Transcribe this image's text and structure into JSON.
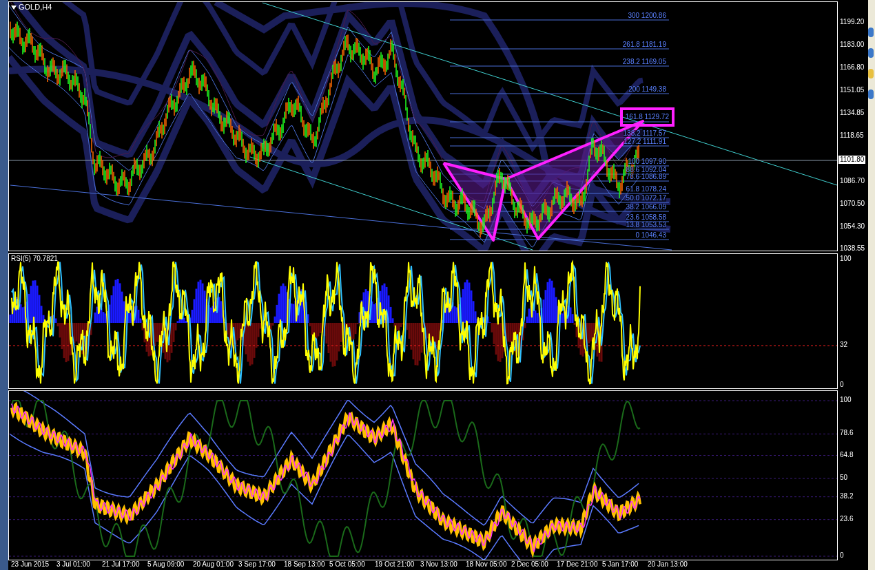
{
  "chart": {
    "title": "GOLD,H4",
    "price_axis": [
      "1199.20",
      "1183.00",
      "1166.80",
      "1151.05",
      "1134.85",
      "1118.65",
      "1086.70",
      "1070.50",
      "1054.30",
      "1038.55"
    ],
    "current_price": "1101.80",
    "fib_levels": [
      {
        "label": "300 1200.86",
        "highlighted": false
      },
      {
        "label": "261.8 1181.19",
        "highlighted": false
      },
      {
        "label": "238.2 1169.05",
        "highlighted": false
      },
      {
        "label": "200 1149.38",
        "highlighted": false
      },
      {
        "label": "161.8 1129.72",
        "highlighted": true
      },
      {
        "label": "138.2 1117.57",
        "highlighted": false
      },
      {
        "label": "127.2 1111.91",
        "highlighted": false
      },
      {
        "label": "100 1097.90",
        "highlighted": false
      },
      {
        "label": "88.6 1092.04",
        "highlighted": false
      },
      {
        "label": "78.6 1086.89",
        "highlighted": false
      },
      {
        "label": "61.8 1078.24",
        "highlighted": false
      },
      {
        "label": "50.0 1072.17",
        "highlighted": false
      },
      {
        "label": "38.2 1066.09",
        "highlighted": false
      },
      {
        "label": "23.6 1058.58",
        "highlighted": false
      },
      {
        "label": "13.8 1053.53",
        "highlighted": false
      },
      {
        "label": "0 1046.43",
        "highlighted": false
      }
    ]
  },
  "rsi_pane": {
    "title": "RSI(5) 70.7821",
    "axis": [
      "100",
      "32",
      "0"
    ]
  },
  "oscillator_pane": {
    "axis": [
      "100",
      "78.6",
      "64.8",
      "50",
      "38.2",
      "23.6",
      "0"
    ]
  },
  "time_axis": [
    "23 Jun 2015",
    "3 Jul 01:00",
    "21 Jul 17:00",
    "5 Aug 09:00",
    "20 Aug 01:00",
    "3 Sep 17:00",
    "18 Sep 13:00",
    "5 Oct 05:00",
    "19 Oct 21:00",
    "3 Nov 13:00",
    "18 Nov 05:00",
    "2 Dec 05:00",
    "17 Dec 21:00",
    "5 Jan 17:00",
    "20 Jan 13:00"
  ]
}
